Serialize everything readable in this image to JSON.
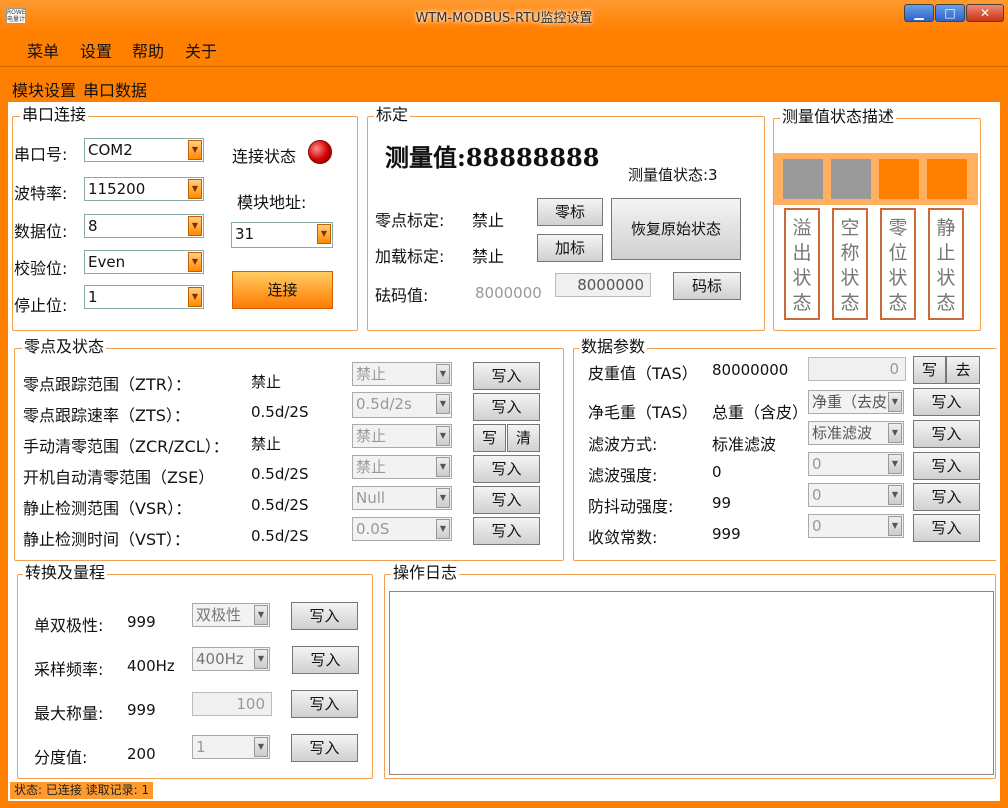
{
  "window": {
    "title": "WTM-MODBUS-RTU监控设置",
    "icon_text": "ROWE 电量计"
  },
  "menu": [
    "菜单",
    "设置",
    "帮助",
    "关于"
  ],
  "tabs": [
    "模块设置",
    "串口数据"
  ],
  "serial": {
    "legend": "串口连接",
    "port_label": "串口号:",
    "port": "COM2",
    "baud_label": "波特率:",
    "baud": "115200",
    "databits_label": "数据位:",
    "databits": "8",
    "parity_label": "校验位:",
    "parity": "Even",
    "stopbits_label": "停止位:",
    "stopbits": "1",
    "conn_status_label": "连接状态",
    "module_addr_label": "模块地址:",
    "module_addr": "31",
    "connect_btn": "连接",
    "led_color": "#cc0000"
  },
  "calib": {
    "legend": "标定",
    "measure_label": "测量值:",
    "measure_value": "88888888",
    "status_text": "测量值状态:3",
    "zero_label": "零点标定:",
    "zero_value": "禁止",
    "zero_btn": "零标",
    "load_label": "加载标定:",
    "load_value": "禁止",
    "load_btn": "加标",
    "restore_btn": "恢复原始状态",
    "weight_label": "砝码值:",
    "weight_value": "8000000",
    "weight_input": "8000000",
    "weight_btn": "码标"
  },
  "state_desc": {
    "legend": "测量值状态描述",
    "boxes": [
      "#9a9a9a",
      "#9a9a9a",
      "#ff8000",
      "#ff8000"
    ],
    "buttons": [
      "溢出状态",
      "空称状态",
      "零位状态",
      "静止状态"
    ]
  },
  "zero": {
    "legend": "零点及状态",
    "rows": [
      {
        "label": "零点跟踪范围（ZTR）：",
        "value": "禁止",
        "select": "禁止",
        "btn": "写入"
      },
      {
        "label": "零点跟踪速率（ZTS）：",
        "value": "0.5d/2S",
        "select": "0.5d/2s",
        "btn": "写入"
      },
      {
        "label": "手动清零范围（ZCR/ZCL）：",
        "value": "禁止",
        "select": "禁止",
        "btn": "写",
        "btn2": "清"
      },
      {
        "label": "开机自动清零范围（ZSE）",
        "value": "0.5d/2S",
        "select": "禁止",
        "btn": "写入"
      },
      {
        "label": "静止检测范围（VSR）：",
        "value": "0.5d/2S",
        "select": "Null",
        "btn": "写入"
      },
      {
        "label": "静止检测时间（VST）：",
        "value": "0.5d/2S",
        "select": "0.0S",
        "btn": "写入"
      }
    ]
  },
  "params": {
    "legend": "数据参数",
    "tare": {
      "label": "皮重值（TAS）",
      "value": "80000000",
      "input": "0",
      "btn": "写",
      "btn2": "去"
    },
    "rows": [
      {
        "label": "净毛重（TAS）",
        "value": "总重（含皮）",
        "select": "净重（去皮",
        "btn": "写入"
      },
      {
        "label": "滤波方式:",
        "value": "标准滤波",
        "select": "标准滤波",
        "btn": "写入"
      },
      {
        "label": "滤波强度:",
        "value": "0",
        "select": "0",
        "btn": "写入"
      },
      {
        "label": "防抖动强度:",
        "value": "99",
        "select": "0",
        "btn": "写入"
      },
      {
        "label": "收敛常数:",
        "value": "999",
        "select": "0",
        "btn": "写入"
      }
    ]
  },
  "range": {
    "legend": "转换及量程",
    "rows": [
      {
        "label": "单双极性:",
        "value": "999",
        "select": "双极性",
        "btn": "写入"
      },
      {
        "label": "采样频率:",
        "value": "400Hz",
        "select": "400Hz",
        "btn": "写入"
      },
      {
        "label": "最大称量:",
        "value": "999",
        "input": "100",
        "btn": "写入"
      },
      {
        "label": "分度值:",
        "value": "200",
        "select": "1",
        "btn": "写入"
      }
    ]
  },
  "log": {
    "legend": "操作日志"
  },
  "statusbar": {
    "text": "状态: 已连接 读取记录: 1"
  }
}
